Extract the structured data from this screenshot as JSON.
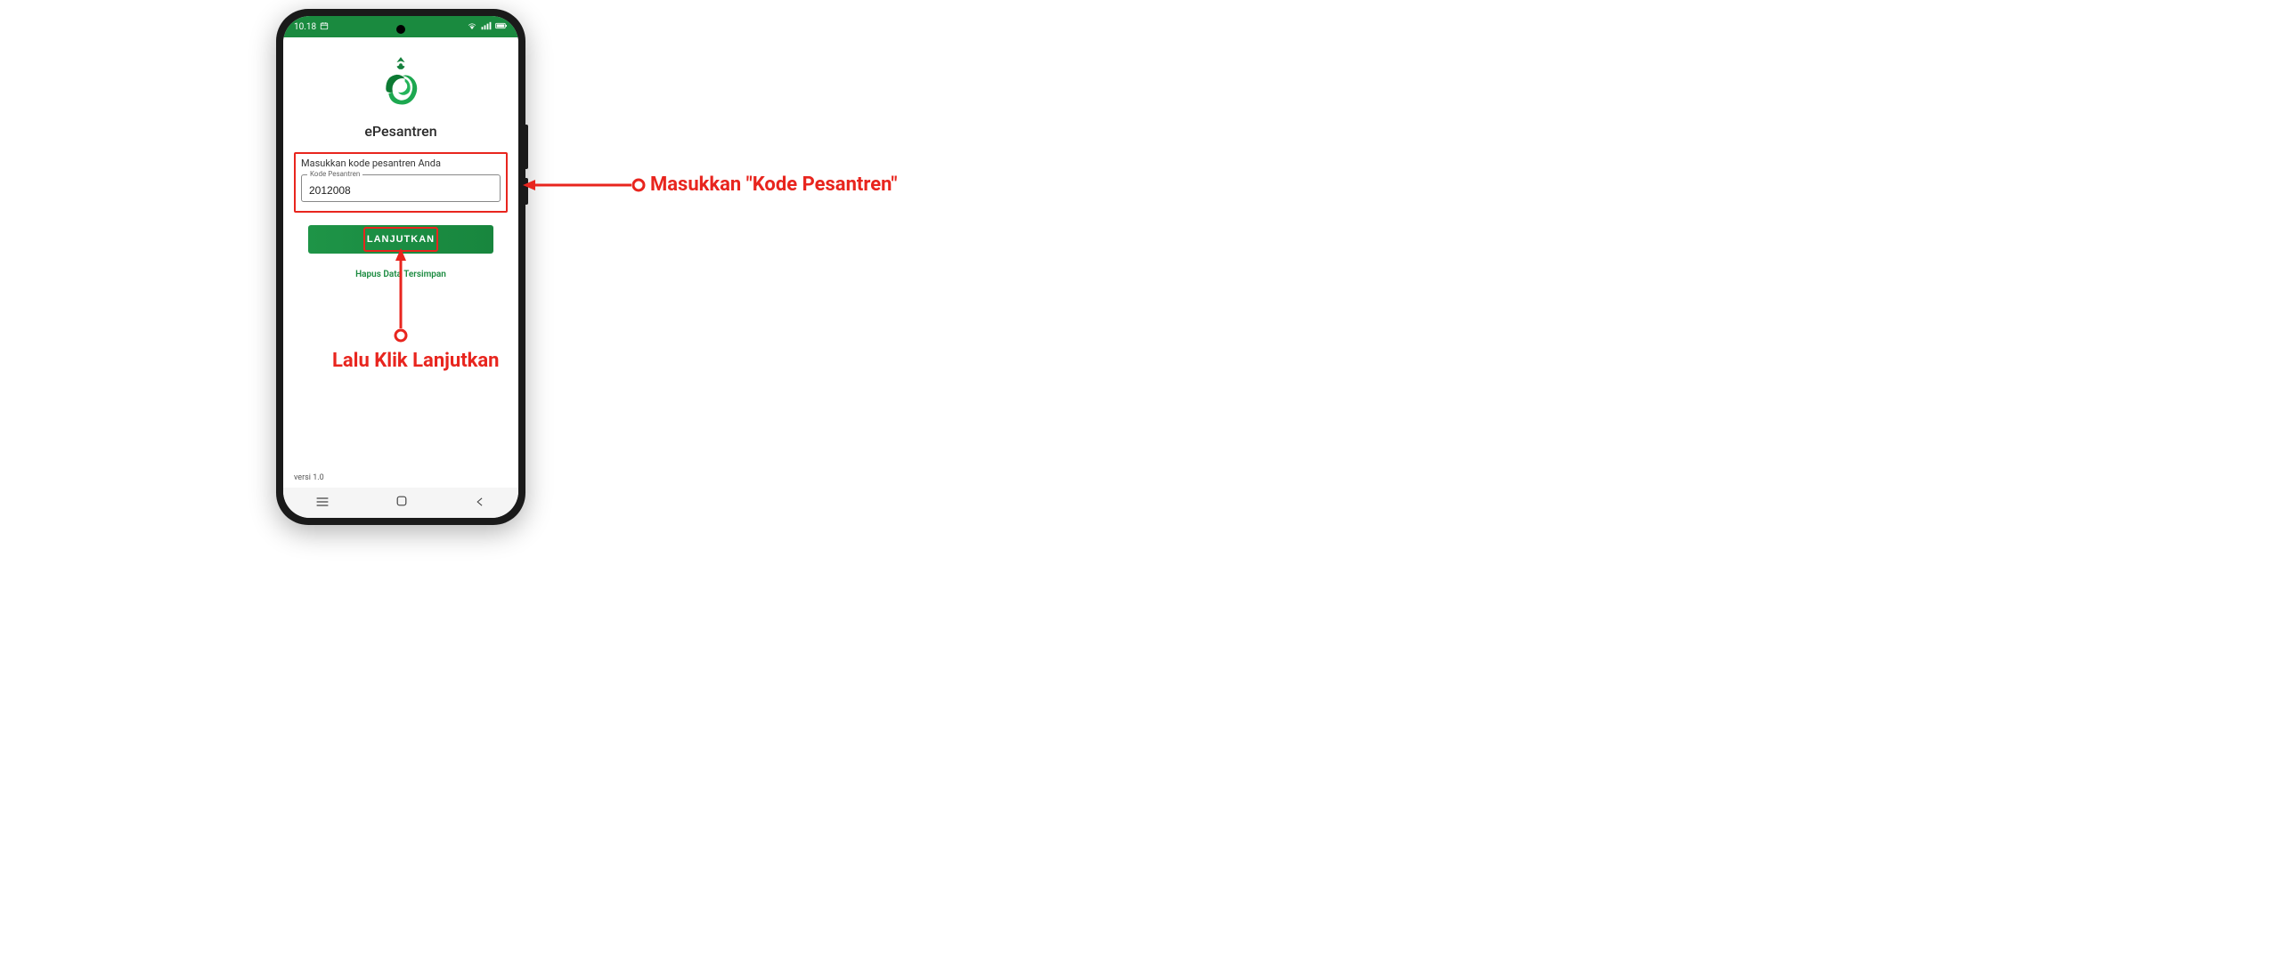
{
  "statusbar": {
    "time": "10.18",
    "calendar_icon": "calendar-icon"
  },
  "app": {
    "name": "ePesantren",
    "input_prompt": "Masukkan kode pesantren Anda",
    "field_label": "Kode Pesantren",
    "field_value": "2012008",
    "submit_label": "LANJUTKAN",
    "clear_link": "Hapus Data Tersimpan",
    "version": "versi 1.0"
  },
  "annotations": {
    "input_note": "Masukkan \"Kode Pesantren\"",
    "button_note": "Lalu Klik Lanjutkan"
  },
  "colors": {
    "brand_green": "#1a8a3f",
    "highlight_red": "#e8251e"
  }
}
